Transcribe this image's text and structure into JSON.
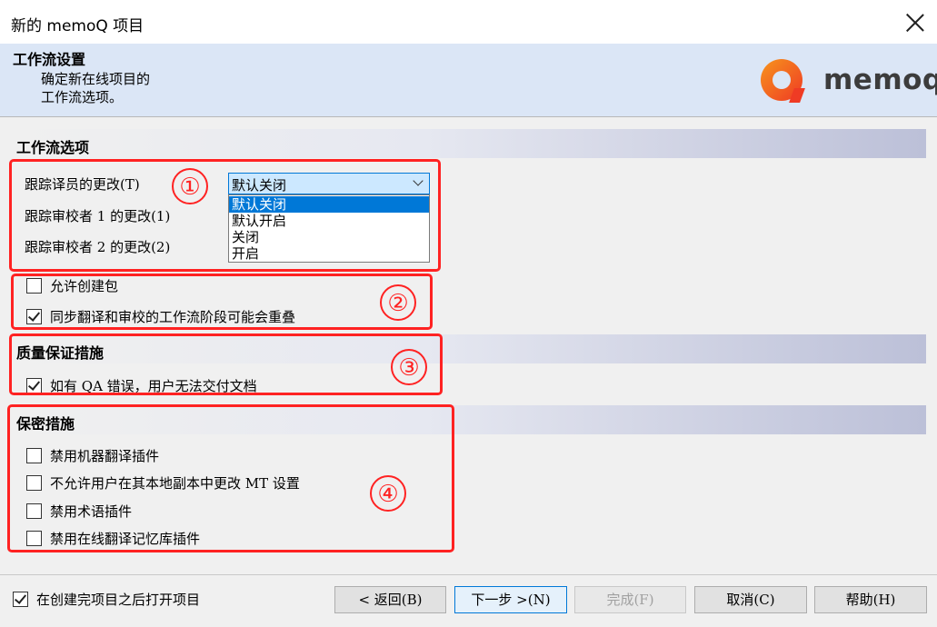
{
  "window": {
    "title": "新的 memoQ 项目",
    "close_icon": "close-icon"
  },
  "header": {
    "title": "工作流设置",
    "description": "确定新在线项目的工作流选项。",
    "logo_text": "memoq"
  },
  "workflow": {
    "section_title": "工作流选项",
    "rows": [
      {
        "label": "跟踪译员的更改(T)"
      },
      {
        "label": "跟踪审校者 1 的更改(1)"
      },
      {
        "label": "跟踪审校者 2 的更改(2)"
      }
    ],
    "combo_value": "默认关闭",
    "dropdown_options": [
      "默认关闭",
      "默认开启",
      "关闭",
      "开启"
    ],
    "allow_package": "允许创建包",
    "sync_overlap": "同步翻译和审校的工作流阶段可能会重叠"
  },
  "qa": {
    "section_title": "质量保证措施",
    "block_delivery": "如有 QA 错误，用户无法交付文档"
  },
  "confidential": {
    "section_title": "保密措施",
    "items": [
      "禁用机器翻译插件",
      "不允许用户在其本地副本中更改 MT 设置",
      "禁用术语插件",
      "禁用在线翻译记忆库插件"
    ]
  },
  "annotations": [
    "①",
    "②",
    "③",
    "④"
  ],
  "footer": {
    "open_after": "在创建完项目之后打开项目",
    "back": "< 返回(B)",
    "next": "下一步 >(N)",
    "finish": "完成(F)",
    "cancel": "取消(C)",
    "help": "帮助(H)"
  }
}
